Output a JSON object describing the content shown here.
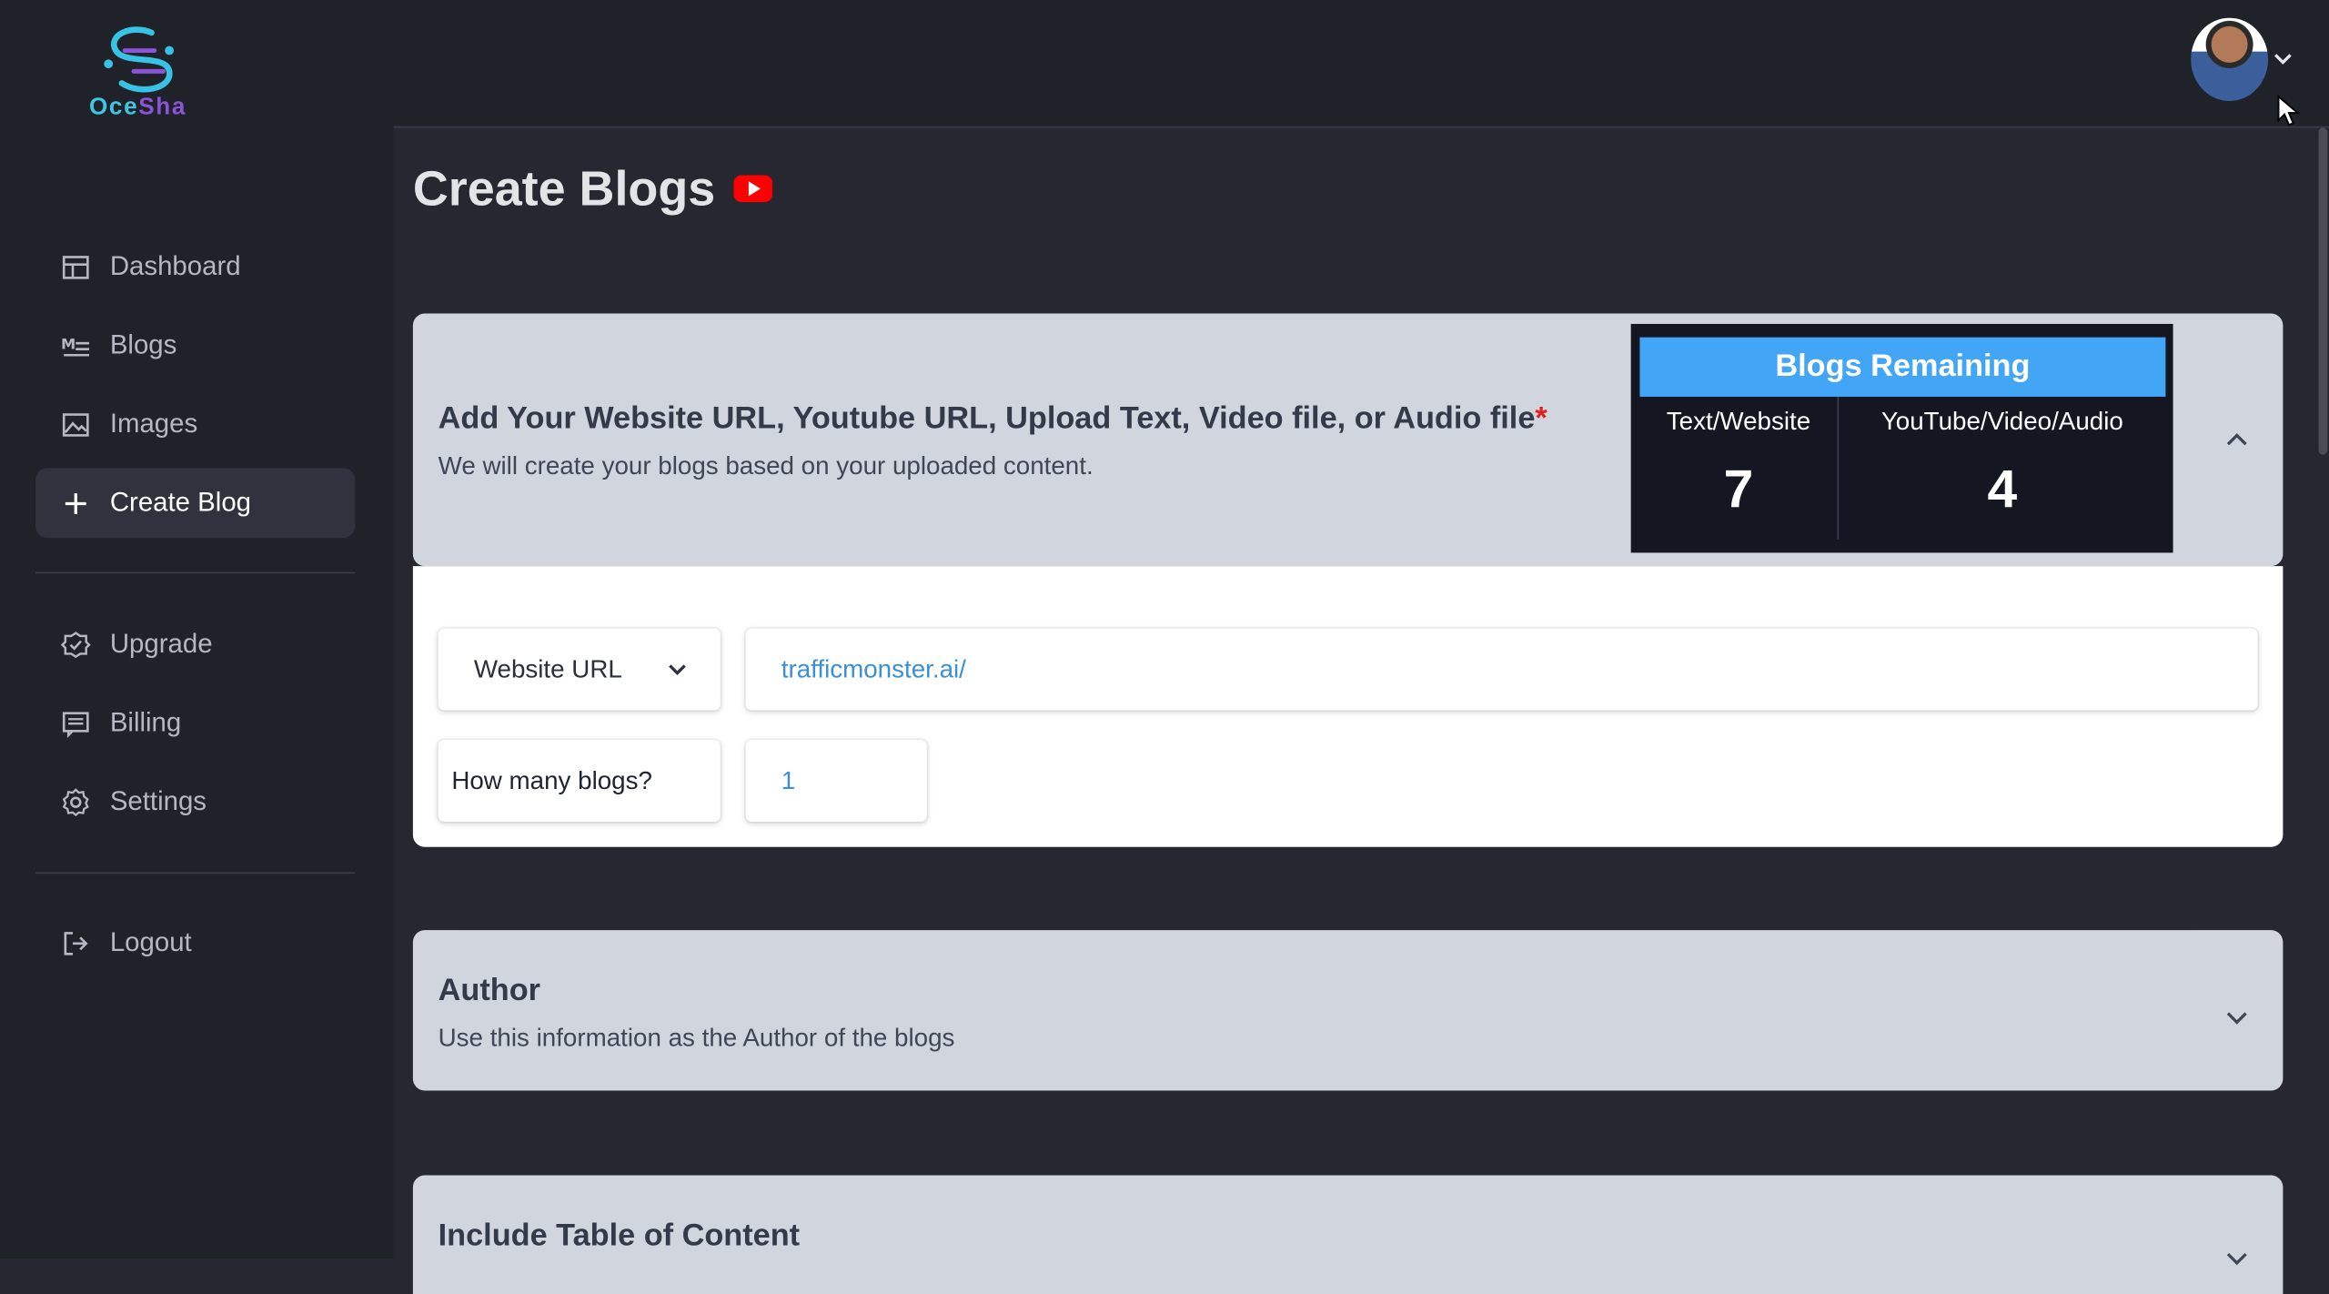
{
  "brand": {
    "logo_text_a": "Oce",
    "logo_text_b": "Sha"
  },
  "sidebar": {
    "items": [
      {
        "label": "Dashboard",
        "icon": "dashboard-icon"
      },
      {
        "label": "Blogs",
        "icon": "markdown-icon"
      },
      {
        "label": "Images",
        "icon": "image-icon"
      },
      {
        "label": "Create Blog",
        "icon": "plus-icon",
        "active": true
      },
      {
        "label": "Upgrade",
        "icon": "badge-check-icon"
      },
      {
        "label": "Billing",
        "icon": "billing-icon"
      },
      {
        "label": "Settings",
        "icon": "gear-icon"
      },
      {
        "label": "Logout",
        "icon": "logout-icon"
      }
    ]
  },
  "header": {
    "title": "Create Blogs",
    "video_icon": "youtube-icon"
  },
  "source_panel": {
    "title": "Add Your Website URL, Youtube URL, Upload Text, Video file, or Audio file",
    "required_mark": "*",
    "subtitle": "We will create your blogs based on your uploaded content.",
    "remaining": {
      "title": "Blogs Remaining",
      "text_label": "Text/Website",
      "text_count": "7",
      "media_label": "YouTube/Video/Audio",
      "media_count": "4"
    },
    "source_type": "Website URL",
    "url_value": "trafficmonster.ai/",
    "count_label": "How many blogs?",
    "count_value": "1"
  },
  "author_panel": {
    "title": "Author",
    "subtitle": "Use this information as the Author of the blogs"
  },
  "toc_panel": {
    "title": "Include Table of Content"
  },
  "colors": {
    "accent": "#42a5f5",
    "link": "#3a8fd6",
    "sidebar_bg": "#20222a",
    "main_bg": "#262731",
    "panel_bg": "#d1d5dd"
  }
}
